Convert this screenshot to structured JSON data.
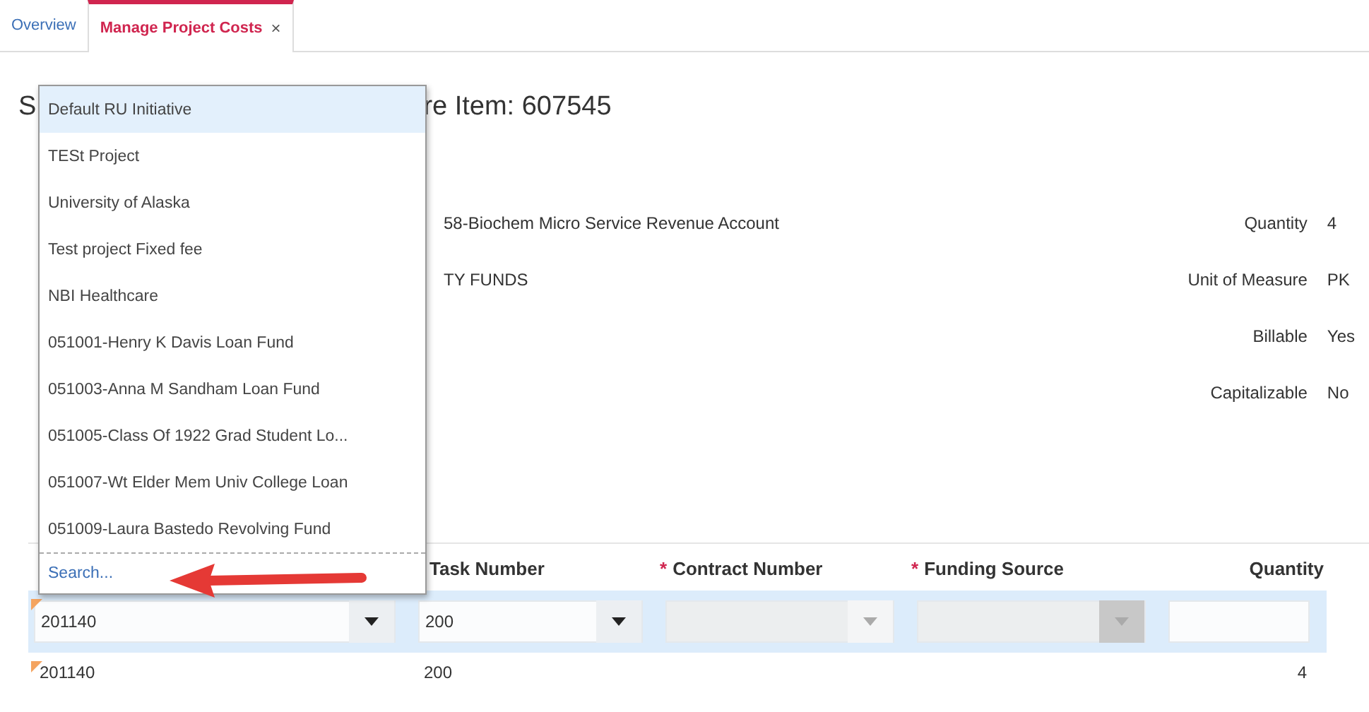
{
  "tabs": [
    {
      "label": "Overview",
      "selected": false
    },
    {
      "label": "Manage Project Costs",
      "selected": true,
      "close": "×"
    }
  ],
  "title": {
    "left": "S",
    "right": "re Item: 607545"
  },
  "details": {
    "left": [
      "58-Biochem Micro Service Revenue Account",
      "TY FUNDS"
    ],
    "right": [
      {
        "label": "Quantity",
        "value": "4"
      },
      {
        "label": "Unit of Measure",
        "value": "PK"
      },
      {
        "label": "Billable",
        "value": "Yes"
      },
      {
        "label": "Capitalizable",
        "value": "No"
      }
    ]
  },
  "table": {
    "columns": [
      {},
      {
        "label": "Task Number"
      },
      {
        "label": "Contract Number",
        "required_mark": "*"
      },
      {
        "label": "Funding Source",
        "required_mark": "*"
      },
      {
        "label": "Quantity"
      }
    ],
    "rows": [
      {
        "selected": true,
        "cells": [
          {
            "kind": "combo",
            "value": "201140",
            "flag": true
          },
          {
            "kind": "combo",
            "value": "200",
            "flag": false
          },
          {
            "kind": "select",
            "disabled": true
          },
          {
            "kind": "select",
            "disabled": true
          },
          {
            "kind": "input"
          }
        ]
      },
      {
        "selected": false,
        "cells": [
          {
            "kind": "text",
            "value": "201140",
            "flag": true
          },
          {
            "kind": "text",
            "value": "200",
            "flag": false
          },
          {
            "kind": "empty"
          },
          {
            "kind": "empty"
          },
          {
            "kind": "number",
            "value": "4"
          }
        ]
      }
    ]
  },
  "dropdown": {
    "items": [
      {
        "label": "Default RU Initiative",
        "selected": true
      },
      {
        "label": "TESt Project",
        "selected": false
      },
      {
        "label": "University of Alaska",
        "selected": false
      },
      {
        "label": "Test project Fixed fee",
        "selected": false
      },
      {
        "label": "NBI Healthcare",
        "selected": false
      },
      {
        "label": "051001-Henry K Davis Loan Fund",
        "selected": false
      },
      {
        "label": "051003-Anna M Sandham Loan Fund",
        "selected": false
      },
      {
        "label": "051005-Class Of 1922 Grad Student Lo...",
        "selected": false
      },
      {
        "label": "051007-Wt Elder Mem Univ College Loan",
        "selected": false
      },
      {
        "label": "051009-Laura Bastedo Revolving Fund",
        "selected": false
      }
    ],
    "search_link": "Search..."
  }
}
